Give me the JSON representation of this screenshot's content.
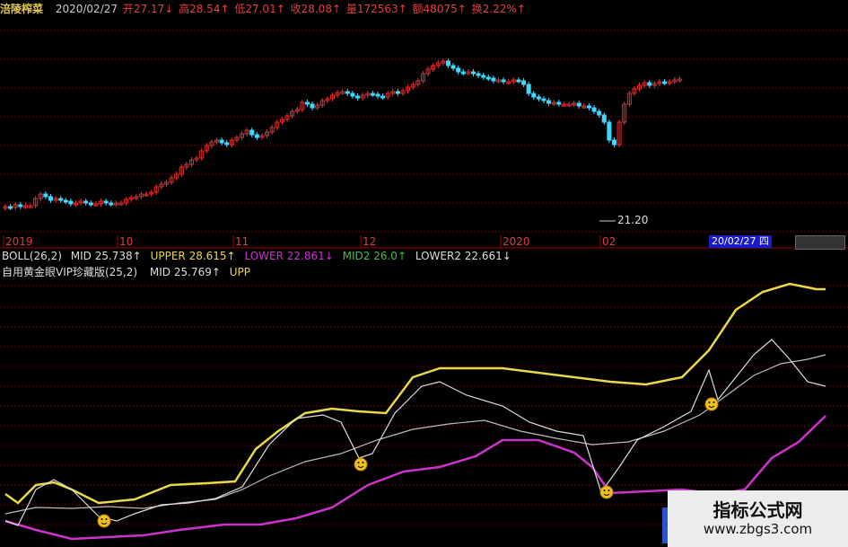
{
  "header": {
    "stock_name": "涪陵榨菜",
    "date": "2020/02/27",
    "fields": [
      "开27.17↓",
      "高28.54↑",
      "低27.01↑",
      "收28.08↑",
      "量172563↑",
      "额48075↑",
      "换2.22%↑"
    ]
  },
  "price_chart": {
    "low_annotation": "21.20",
    "x_labels": [
      "2019",
      "10",
      "11",
      "12",
      "2020",
      "02"
    ],
    "current_date_label": "20/02/27 四",
    "colors": {
      "up": "#e03030",
      "down": "#40d8ff",
      "grid": "#7a0000"
    }
  },
  "indicators": {
    "boll": {
      "name": "BOLL(26,2)",
      "mid": "MID 25.738↑",
      "upper": "UPPER 28.615↑",
      "lower": "LOWER 22.861↓",
      "mid2": "MID2 26.0↑",
      "lower2": "LOWER2 22.661↓"
    },
    "vip": {
      "name": "自用黄金眼VIP珍藏版(25,2)",
      "mid": "MID 25.769↑",
      "upper": "UPP"
    },
    "colors": {
      "upper": "#e8d84a",
      "lower": "#cc33cc",
      "mid": "#bbbbbb",
      "price": "#dddddd",
      "marker": "#f0c020"
    }
  },
  "watermark": {
    "title": "指标公式网",
    "url": "www.zbgs3.com"
  }
}
